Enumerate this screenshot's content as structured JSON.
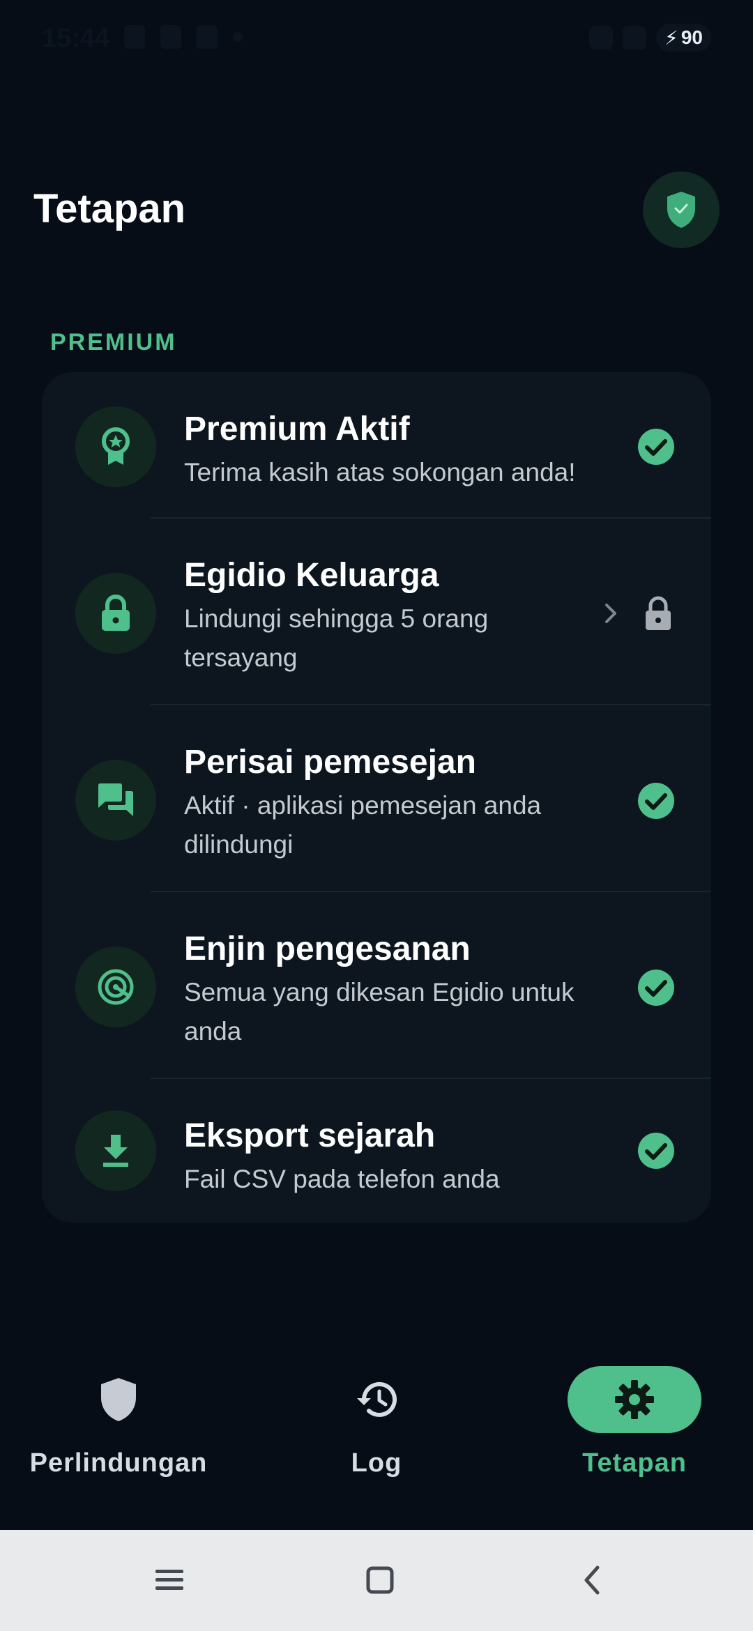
{
  "status_bar": {
    "time": "15:44",
    "battery": "90"
  },
  "header": {
    "title": "Tetapan"
  },
  "section": {
    "label": "PREMIUM"
  },
  "items": [
    {
      "title": "Premium Aktif",
      "subtitle": "Terima kasih atas sokongan anda!",
      "icon": "award-icon",
      "status": "check"
    },
    {
      "title": "Egidio Keluarga",
      "subtitle": "Lindungi sehingga 5 orang tersayang",
      "icon": "lock-icon",
      "status": "locked"
    },
    {
      "title": "Perisai pemesejan",
      "subtitle": "Aktif · aplikasi pemesejan anda dilindungi",
      "icon": "chat-icon",
      "status": "check"
    },
    {
      "title": "Enjin pengesanan",
      "subtitle": "Semua yang dikesan Egidio untuk anda",
      "icon": "radar-icon",
      "status": "check"
    },
    {
      "title": "Eksport sejarah",
      "subtitle": "Fail CSV pada telefon anda",
      "icon": "download-icon",
      "status": "check"
    }
  ],
  "nav": {
    "protection": "Perlindungan",
    "log": "Log",
    "settings": "Tetapan"
  },
  "colors": {
    "background": "#060d17",
    "card": "#0d161f",
    "accent": "#4fbf8b"
  }
}
